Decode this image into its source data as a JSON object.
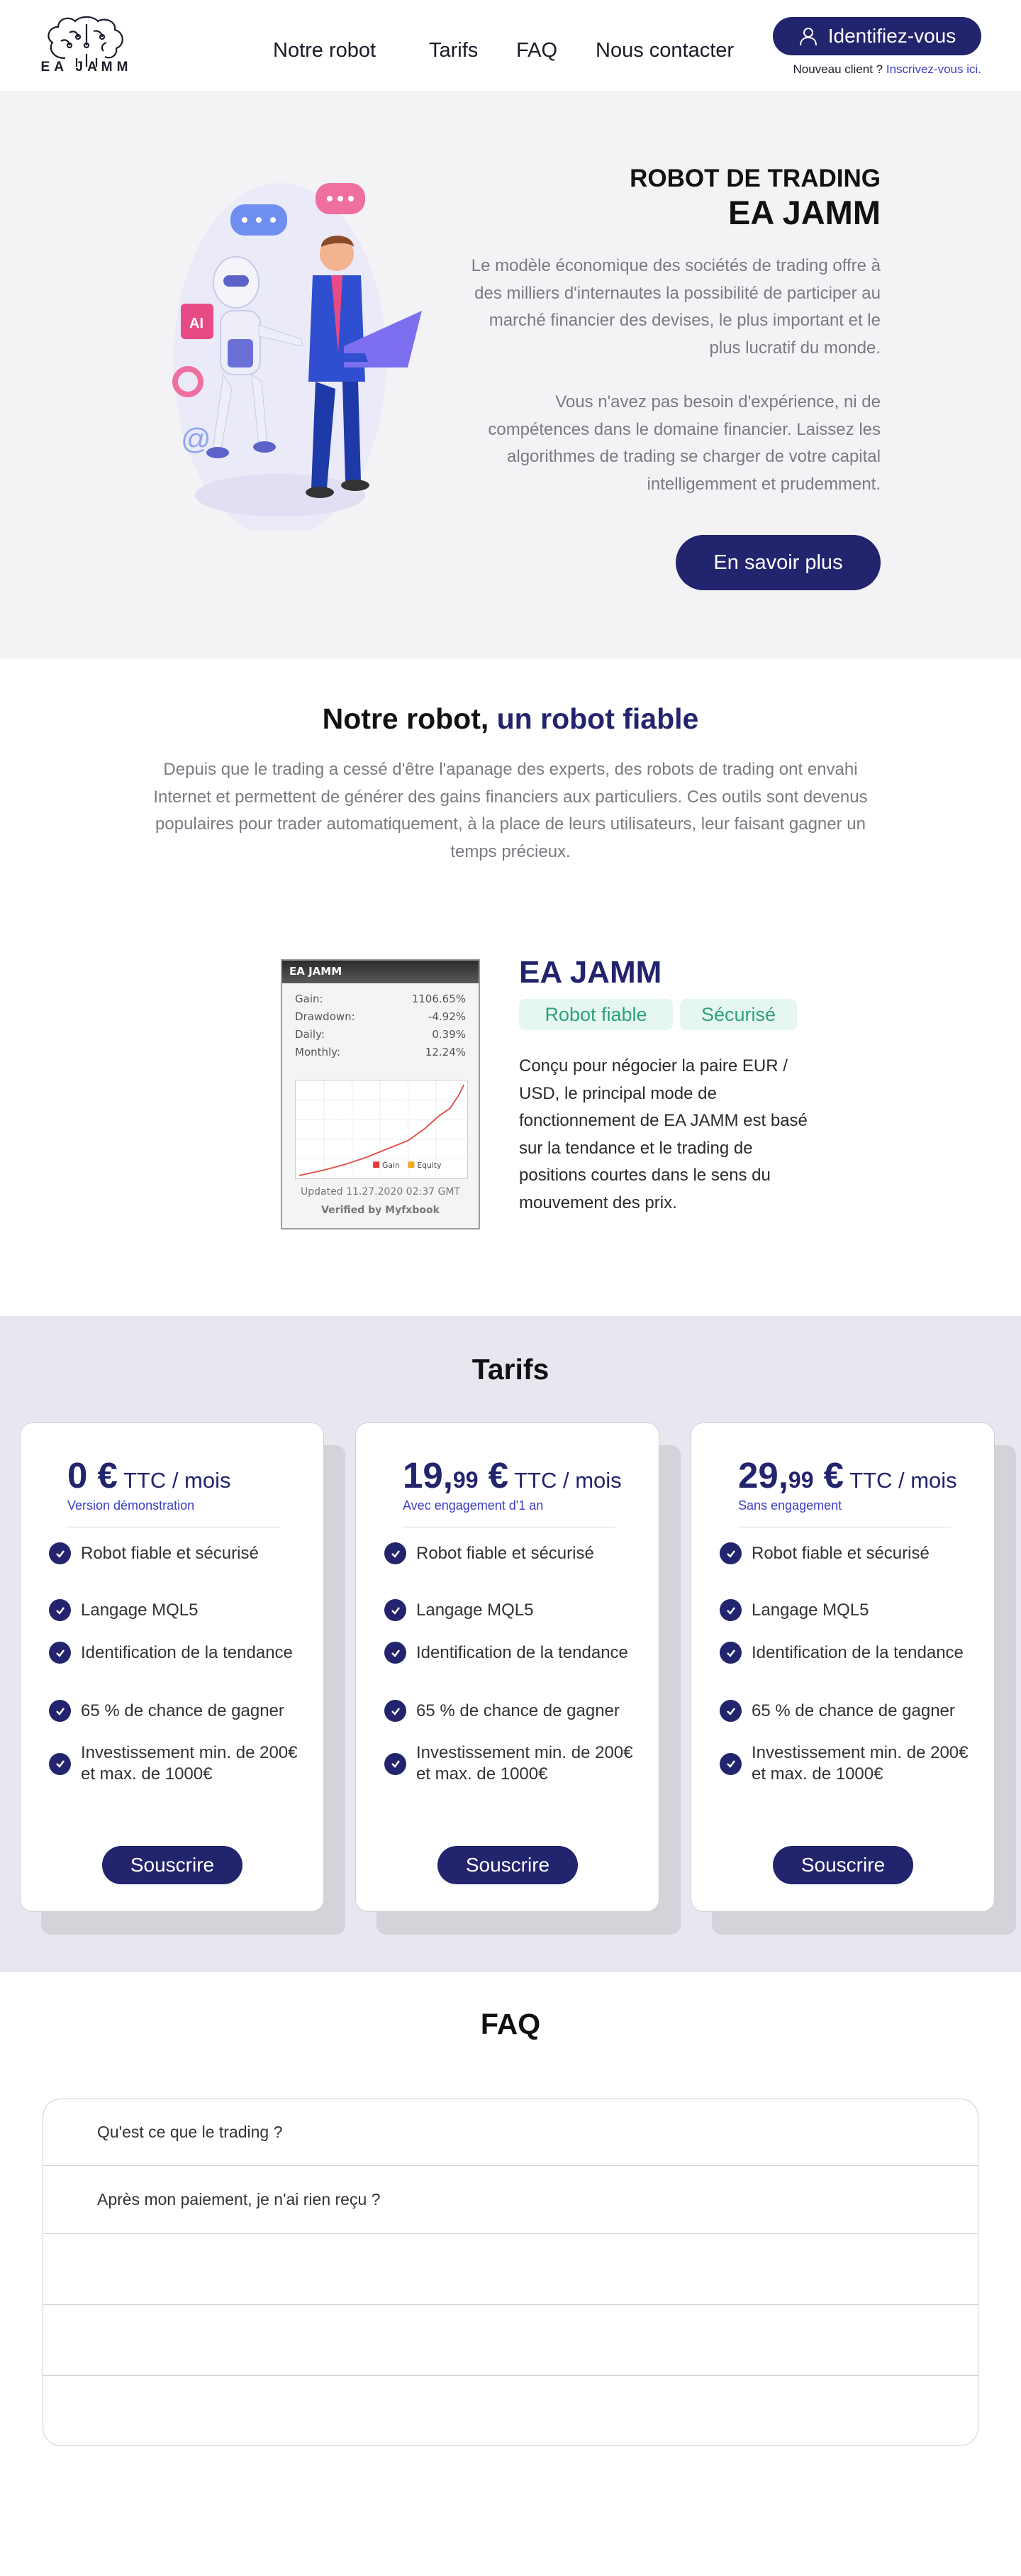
{
  "header": {
    "logo_text": "EA JAMM",
    "nav": [
      "Notre robot",
      "Tarifs",
      "FAQ",
      "Nous contacter"
    ],
    "login_label": "Identifiez-vous",
    "register_prefix": "Nouveau client ? ",
    "register_link": "Inscrivez-vous ici."
  },
  "hero": {
    "kicker": "ROBOT DE TRADING",
    "title": "EA JAMM",
    "p1": "Le modèle économique des sociétés de trading offre à des milliers d'internautes la possibilité de participer au marché financier des devises, le plus important et le plus lucratif du monde.",
    "p2": "Vous n'avez pas besoin d'expérience, ni de compétences dans le domaine financier. Laissez les algorithmes de trading se charger de votre capital intelligemment et prudemment.",
    "cta": "En savoir plus",
    "illus_label": "AI"
  },
  "robot": {
    "title_main": "Notre robot, ",
    "title_accent": "un robot fiable",
    "intro": "Depuis que le trading a cessé d'être l'apanage des experts, des robots de trading ont envahi Internet et permettent de générer des gains financiers aux particuliers. Ces outils sont devenus populaires pour trader automatiquement, à la place de leurs utilisateurs, leur faisant gagner un temps précieux.",
    "widget": {
      "header": "EA JAMM",
      "stats": [
        {
          "label": "Gain:",
          "value": "1106.65%"
        },
        {
          "label": "Drawdown:",
          "value": "-4.92%"
        },
        {
          "label": "Daily:",
          "value": "0.39%"
        },
        {
          "label": "Monthly:",
          "value": "12.24%"
        }
      ],
      "legend_gain": "Gain",
      "legend_equity": "Equity",
      "updated": "Updated 11.27.2020 02:37 GMT",
      "verified": "Verified by Myfxbook"
    },
    "name": "EA JAMM",
    "tags": [
      "Robot fiable",
      "Sécurisé"
    ],
    "desc": "Conçu pour négocier la paire EUR / USD, le principal mode de fonctionnement de EA JAMM est basé sur la tendance et le trading de positions courtes dans le sens du mouvement des prix."
  },
  "pricing": {
    "title": "Tarifs",
    "plans": [
      {
        "price_main": "0 €",
        "price_cents": "",
        "unit": " TTC / mois",
        "subtitle": "Version démonstration",
        "button": "Souscrire"
      },
      {
        "price_main": "19,",
        "price_cents": "99",
        "price_euro": " €",
        "unit": " TTC / mois",
        "subtitle": "Avec engagement d'1 an",
        "button": "Souscrire"
      },
      {
        "price_main": "29,",
        "price_cents": "99",
        "price_euro": " €",
        "unit": " TTC / mois",
        "subtitle": "Sans engagement",
        "button": "Souscrire"
      }
    ],
    "features": [
      "Robot fiable et sécurisé",
      "Langage MQL5",
      "Identification de la tendance",
      "65 % de chance de gagner",
      "Investissement min. de 200€ et max. de 1000€"
    ]
  },
  "faq": {
    "title": "FAQ",
    "items": [
      "Qu'est ce que le trading ?",
      "Après mon paiement, je n'ai rien reçu ?",
      "",
      "",
      ""
    ]
  },
  "colors": {
    "brand": "#22246d",
    "link": "#3a3fc0",
    "tag_bg": "#e6f7f1",
    "tag_text": "#2ea07e",
    "hero_bg": "#f3f3f5",
    "pricing_bg": "#e7e8ef"
  }
}
